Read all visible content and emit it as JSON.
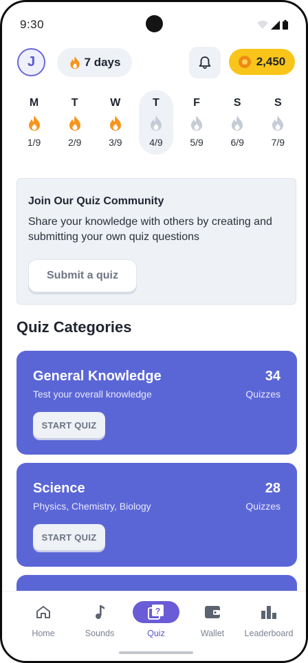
{
  "status_bar": {
    "time": "9:30"
  },
  "header": {
    "avatar_initial": "J",
    "streak_label": "7 days",
    "coins": "2,450"
  },
  "week": [
    {
      "letter": "M",
      "date": "1/9",
      "state": "done"
    },
    {
      "letter": "T",
      "date": "2/9",
      "state": "done"
    },
    {
      "letter": "W",
      "date": "3/9",
      "state": "done"
    },
    {
      "letter": "T",
      "date": "4/9",
      "state": "today"
    },
    {
      "letter": "F",
      "date": "5/9",
      "state": "future"
    },
    {
      "letter": "S",
      "date": "6/9",
      "state": "future"
    },
    {
      "letter": "S",
      "date": "7/9",
      "state": "future"
    }
  ],
  "community": {
    "title": "Join Our Quiz Community",
    "text": "Share your knowledge with others by creating and submitting your own quiz questions",
    "button": "Submit a quiz"
  },
  "categories_title": "Quiz Categories",
  "categories": [
    {
      "name": "General Knowledge",
      "desc": "Test your overall knowledge",
      "count": "34",
      "unit": "Quizzes",
      "button": "START QUIZ"
    },
    {
      "name": "Science",
      "desc": "Physics, Chemistry, Biology",
      "count": "28",
      "unit": "Quizzes",
      "button": "START QUIZ"
    }
  ],
  "nav": [
    {
      "label": "Home",
      "icon": "home-icon"
    },
    {
      "label": "Sounds",
      "icon": "music-note-icon"
    },
    {
      "label": "Quiz",
      "icon": "quiz-icon",
      "active": true
    },
    {
      "label": "Wallet",
      "icon": "wallet-icon"
    },
    {
      "label": "Leaderboard",
      "icon": "leaderboard-icon"
    }
  ],
  "colors": {
    "accent": "#5b66d6",
    "nav_active": "#6a5bd6",
    "coins_bg": "#f9c51a",
    "flame_active": "#f7941d",
    "flame_inactive": "#c5ccd6"
  }
}
